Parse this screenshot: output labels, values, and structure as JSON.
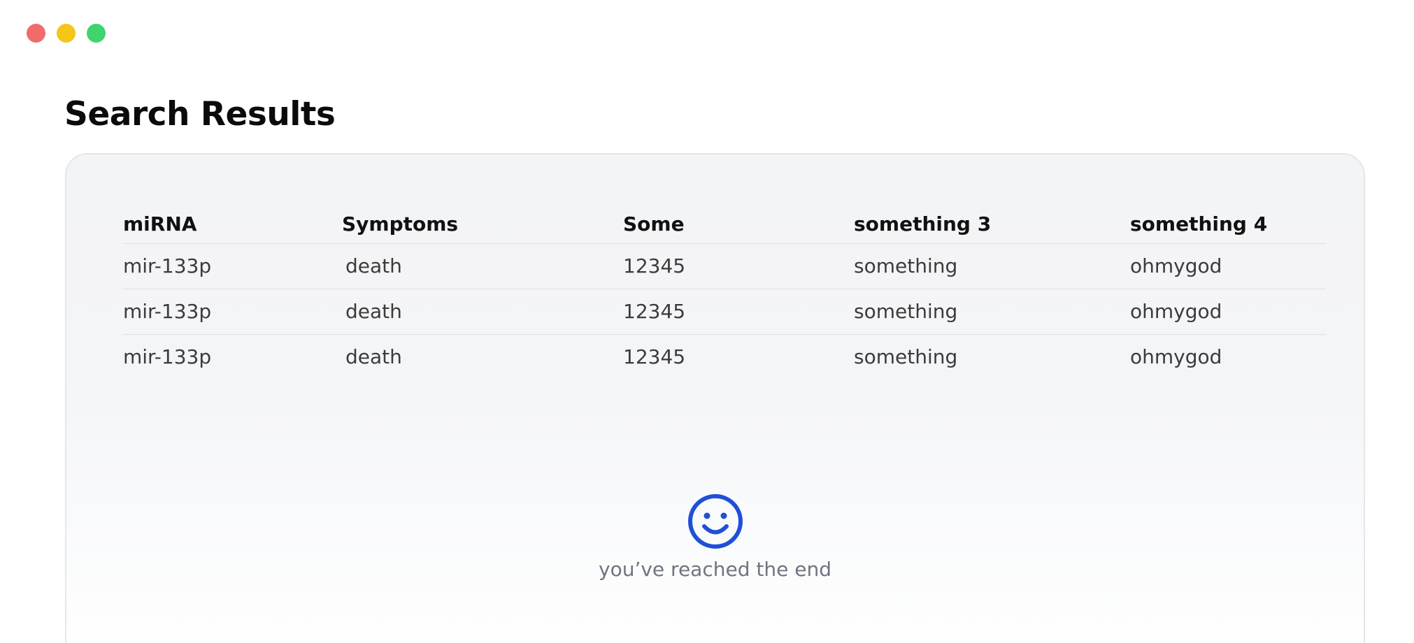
{
  "page": {
    "title": "Search Results"
  },
  "table": {
    "columns": [
      "miRNA",
      "Symptoms",
      "Some",
      "something 3",
      "something 4"
    ],
    "rows": [
      [
        "mir-133p",
        "death",
        "12345",
        "something",
        "ohmygod"
      ],
      [
        "mir-133p",
        "death",
        "12345",
        "something",
        "ohmygod"
      ],
      [
        "mir-133p",
        "death",
        "12345",
        "something",
        "ohmygod"
      ]
    ]
  },
  "end_state": {
    "icon": "smile-icon",
    "message": "you’ve reached the end"
  },
  "colors": {
    "accent": "#1f4fd8",
    "traffic_red": "#f16b6b",
    "traffic_yellow": "#f5c518",
    "traffic_green": "#3fd46e"
  }
}
